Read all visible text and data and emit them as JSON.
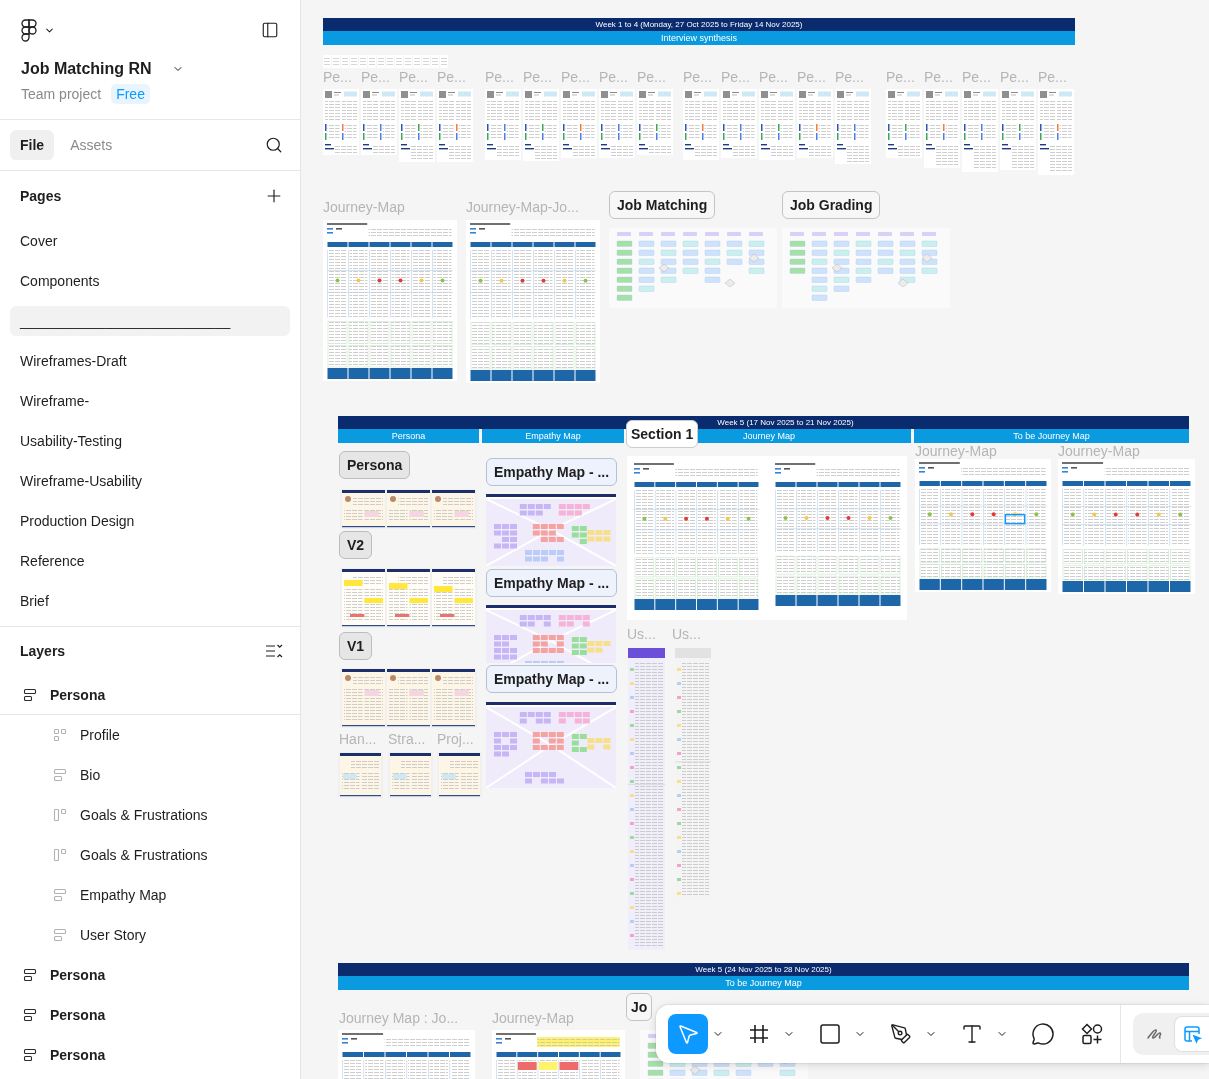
{
  "sidebar": {
    "file_name": "Job Matching RN",
    "team": "Team project",
    "plan": "Free",
    "tabs": [
      {
        "label": "File",
        "selected": true
      },
      {
        "label": "Assets",
        "selected": false
      }
    ],
    "pages_title": "Pages",
    "pages": [
      {
        "label": "Cover",
        "selected": false
      },
      {
        "label": "Components",
        "selected": false
      },
      {
        "label": "___________________________",
        "selected": true
      },
      {
        "label": "Wireframes-Draft",
        "selected": false
      },
      {
        "label": "Wireframe-",
        "selected": false
      },
      {
        "label": "Usability-Testing",
        "selected": false
      },
      {
        "label": "Wireframe-Usability",
        "selected": false
      },
      {
        "label": "Production Design",
        "selected": false
      },
      {
        "label": "Reference",
        "selected": false
      },
      {
        "label": "Brief",
        "selected": false
      }
    ],
    "layers_title": "Layers",
    "layers": [
      {
        "name": "Persona",
        "kind": "stack",
        "children": [
          {
            "name": "Profile",
            "kind": "grid"
          },
          {
            "name": "Bio",
            "kind": "stack"
          },
          {
            "name": "Goals & Frustrations",
            "kind": "columns"
          },
          {
            "name": "Goals & Frustrations",
            "kind": "columns"
          },
          {
            "name": "Empathy Map",
            "kind": "stack"
          },
          {
            "name": "User Story",
            "kind": "stack"
          }
        ]
      },
      {
        "name": "Persona",
        "kind": "stack"
      },
      {
        "name": "Persona",
        "kind": "stack"
      },
      {
        "name": "Persona",
        "kind": "stack"
      }
    ]
  },
  "canvas": {
    "interview": {
      "week": "Week 1 to 4 (Monday, 27 Oct 2025 to Friday 14 Nov 2025)",
      "columns": [
        "Interview synthesis"
      ],
      "frame_titles": [
        "Pe...",
        "Pe...",
        "Pe...",
        "Pe...",
        "Pe...",
        "Pe...",
        "Pe...",
        "Pe...",
        "Pe...",
        "Pe...",
        "Pe...",
        "Pe...",
        "Pe...",
        "Pe...",
        "Pe...",
        "Pe...",
        "Pe...",
        "Pe...",
        "Pe..."
      ]
    },
    "journeys": {
      "frame_titles": [
        "Journey-Map",
        "Journey-Map-Jo..."
      ],
      "labels": [
        "Job Matching",
        "Job Grading"
      ]
    },
    "week5": {
      "week": "Week 5 (17 Nov 2025 to 21 Nov 2025)",
      "columns": [
        "Persona",
        "Empathy Map",
        "Journey Map",
        "To be Journey Map"
      ],
      "section_label": "Section 1",
      "persona_label": "Persona",
      "versions": [
        "V2",
        "V1"
      ],
      "persona_frame_titles": [
        "Han...",
        "Stra...",
        "Proj..."
      ],
      "empathy_labels": [
        "Empathy Map - ...",
        "Empathy Map - ...",
        "Empathy Map - ..."
      ],
      "journey_titles": [
        "Journey-Map",
        "Journey-Map"
      ],
      "story_titles": [
        "Us...",
        "Us..."
      ]
    },
    "week6": {
      "week": "Week 5 (24 Nov 2025 to 28 Nov 2025)",
      "columns": [
        "To be Journey Map"
      ],
      "frame_titles": [
        "Journey Map : Jo...",
        "Journey-Map"
      ],
      "label": "Jo"
    }
  },
  "toolbar": {
    "tools": [
      {
        "kind": "move",
        "selected": true,
        "menu": true
      },
      {
        "kind": "frame",
        "selected": false,
        "menu": true
      },
      {
        "kind": "shape",
        "selected": false,
        "menu": true
      },
      {
        "kind": "pen",
        "selected": false,
        "menu": true
      },
      {
        "kind": "text",
        "selected": false,
        "menu": true
      },
      {
        "kind": "comment",
        "selected": false,
        "menu": false
      },
      {
        "kind": "actions",
        "selected": false,
        "menu": false
      }
    ],
    "modes": [
      {
        "kind": "draw",
        "selected": false
      },
      {
        "kind": "design",
        "selected": true
      }
    ]
  }
}
